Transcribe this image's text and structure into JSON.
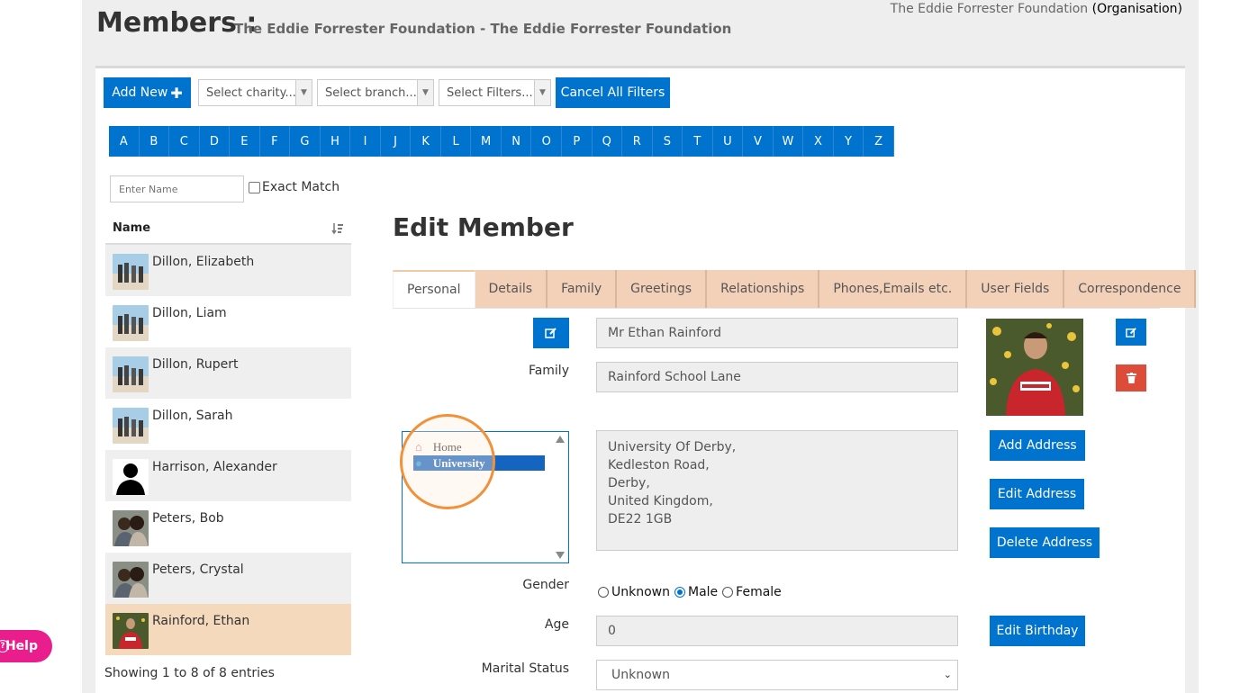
{
  "header": {
    "title": "Members :",
    "subtitle": "The Eddie Forrester Foundation - The Eddie Forrester Foundation",
    "org_name": "The Eddie Forrester Foundation",
    "org_type": "(Organisation)"
  },
  "toolbar": {
    "add_new": "Add New",
    "select_charity": "Select charity...",
    "select_branch": "Select branch...",
    "select_filters": "Select Filters...",
    "cancel_filters": "Cancel All Filters"
  },
  "alphabet": [
    "A",
    "B",
    "C",
    "D",
    "E",
    "F",
    "G",
    "H",
    "I",
    "J",
    "K",
    "L",
    "M",
    "N",
    "O",
    "P",
    "Q",
    "R",
    "S",
    "T",
    "U",
    "V",
    "W",
    "X",
    "Y",
    "Z"
  ],
  "search": {
    "placeholder": "Enter Name",
    "exact_match": "Exact Match"
  },
  "members": {
    "column": "Name",
    "rows": [
      {
        "name": "Dillon, Elizabeth",
        "photo": "family-photo"
      },
      {
        "name": "Dillon, Liam",
        "photo": "family-photo"
      },
      {
        "name": "Dillon, Rupert",
        "photo": "family-photo"
      },
      {
        "name": "Dillon, Sarah",
        "photo": "family-photo"
      },
      {
        "name": "Harrison, Alexander",
        "photo": "silhouette"
      },
      {
        "name": "Peters, Bob",
        "photo": "couple-photo"
      },
      {
        "name": "Peters, Crystal",
        "photo": "couple-photo"
      },
      {
        "name": "Rainford, Ethan",
        "photo": "portrait-photo"
      }
    ],
    "selected_index": 7,
    "showing": "Showing 1 to 8 of 8 entries"
  },
  "edit": {
    "title": "Edit Member",
    "tabs": [
      "Personal",
      "Details",
      "Family",
      "Greetings",
      "Relationships",
      "Phones,Emails etc.",
      "User Fields",
      "Correspondence"
    ],
    "active_tab": 0,
    "name_value": "Mr Ethan Rainford",
    "family_label": "Family",
    "family_value": "Rainford School Lane",
    "address_options": [
      {
        "label": "Home",
        "icon": "home-icon",
        "color": "#e8588a"
      },
      {
        "label": "University",
        "icon": "person-icon",
        "color": "#2e9bd6"
      }
    ],
    "address_selected": 1,
    "address_lines": [
      "University Of Derby,",
      "Kedleston Road,",
      "Derby,",
      "United Kingdom,",
      "DE22 1GB"
    ],
    "add_address": "Add Address",
    "edit_address": "Edit Address",
    "delete_address": "Delete Address",
    "gender_label": "Gender",
    "gender_options": [
      "Unknown",
      "Male",
      "Female"
    ],
    "gender_selected": "Male",
    "age_label": "Age",
    "age_value": "0",
    "edit_birthday": "Edit Birthday",
    "marital_label": "Marital Status",
    "marital_value": "Unknown"
  },
  "help": {
    "label": "Help"
  },
  "colors": {
    "accent": "#0073cf",
    "tab_bg": "#f3d1b8",
    "selected_row": "#f5d9bd",
    "danger": "#dd4b39",
    "help": "#e91e8c",
    "highlight": "#f0923a"
  }
}
